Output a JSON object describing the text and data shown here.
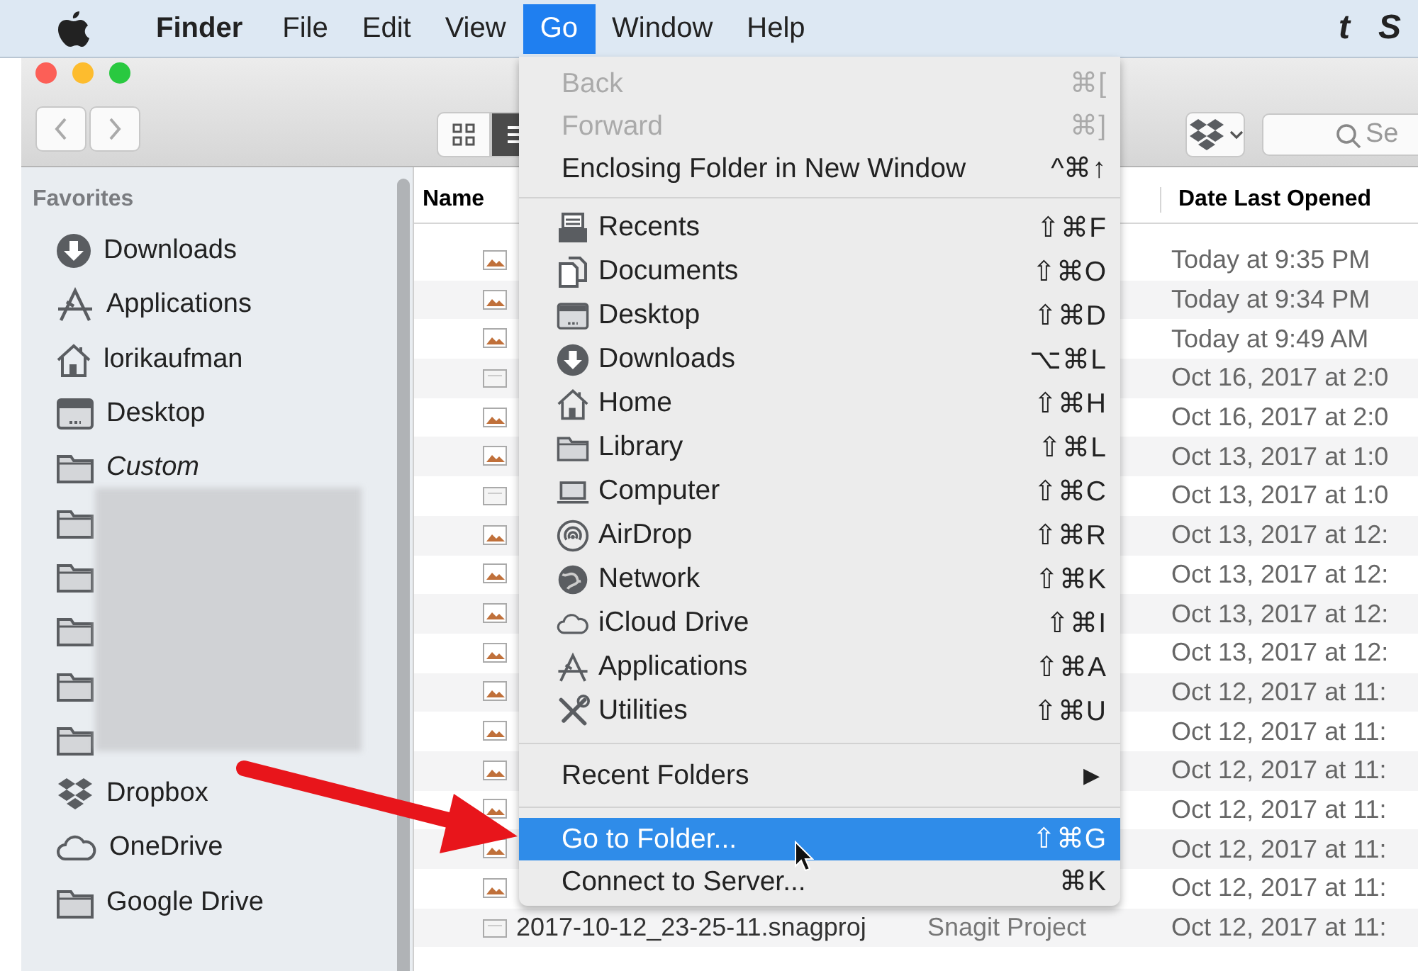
{
  "menu_bar": {
    "app_name": "Finder",
    "menus": [
      {
        "label": "File",
        "selected": false
      },
      {
        "label": "Edit",
        "selected": false
      },
      {
        "label": "View",
        "selected": false
      },
      {
        "label": "Go",
        "selected": true
      },
      {
        "label": "Window",
        "selected": false
      },
      {
        "label": "Help",
        "selected": false
      }
    ],
    "status_items": [
      "t",
      "S"
    ]
  },
  "toolbar": {
    "search": {
      "placeholder": "Se"
    },
    "view_buttons": [
      {
        "kind": "icons",
        "selected": false
      },
      {
        "kind": "list",
        "selected": true
      }
    ]
  },
  "sidebar": {
    "heading": "Favorites",
    "items": [
      {
        "kind": "downloads",
        "label": "Downloads"
      },
      {
        "kind": "applications",
        "label": "Applications"
      },
      {
        "kind": "home",
        "label": "lorikaufman"
      },
      {
        "kind": "desktop",
        "label": "Desktop"
      },
      {
        "kind": "folder",
        "label": "Custom",
        "italic": true
      },
      {
        "kind": "folder"
      },
      {
        "kind": "folder"
      },
      {
        "kind": "folder"
      },
      {
        "kind": "folder"
      },
      {
        "kind": "folder"
      },
      {
        "kind": "dropbox",
        "label": "Dropbox"
      },
      {
        "kind": "cloud",
        "label": "OneDrive"
      },
      {
        "kind": "folder",
        "label": "Google Drive"
      }
    ]
  },
  "file_list": {
    "columns": {
      "name": "Name",
      "date": "Date Last Opened"
    },
    "rows": [
      {
        "kind": "image",
        "date": "Today at 9:35 PM"
      },
      {
        "kind": "image",
        "date": "Today at 9:34 PM"
      },
      {
        "kind": "image",
        "date": "Today at 9:49 AM"
      },
      {
        "kind": "document",
        "date": "Oct 16, 2017 at 2:0"
      },
      {
        "kind": "image",
        "date": "Oct 16, 2017 at 2:0"
      },
      {
        "kind": "image",
        "date": "Oct 13, 2017 at 1:0"
      },
      {
        "kind": "document",
        "date": "Oct 13, 2017 at 1:0"
      },
      {
        "kind": "image",
        "date": "Oct 13, 2017 at 12:"
      },
      {
        "kind": "image",
        "date": "Oct 13, 2017 at 12:"
      },
      {
        "kind": "image",
        "date": "Oct 13, 2017 at 12:"
      },
      {
        "kind": "image",
        "date": "Oct 13, 2017 at 12:"
      },
      {
        "kind": "image",
        "date": "Oct 12, 2017 at 11:"
      },
      {
        "kind": "image",
        "date": "Oct 12, 2017 at 11:"
      },
      {
        "kind": "image",
        "date": "Oct 12, 2017 at 11:"
      },
      {
        "kind": "image",
        "date": "Oct 12, 2017 at 11:"
      },
      {
        "kind": "image",
        "date": "Oct 12, 2017 at 11:"
      },
      {
        "kind": "image",
        "date": "Oct 12, 2017 at 11:"
      },
      {
        "kind": "document",
        "name": "2017-10-12_23-25-11.snagproj",
        "type": "Snagit Project",
        "date": "Oct 12, 2017 at 11:"
      }
    ]
  },
  "go_menu": {
    "sections": [
      [
        {
          "label": "Back",
          "shortcut": "⌘[",
          "disabled": true
        },
        {
          "label": "Forward",
          "shortcut": "⌘]",
          "disabled": true
        },
        {
          "label": "Enclosing Folder in New Window",
          "shortcut": "^⌘↑",
          "disabled": false
        }
      ],
      [
        {
          "kind": "recents",
          "label": "Recents",
          "shortcut": "⇧⌘F",
          "disabled": false
        },
        {
          "kind": "documents",
          "label": "Documents",
          "shortcut": "⇧⌘O",
          "disabled": false
        },
        {
          "kind": "desktop",
          "label": "Desktop",
          "shortcut": "⇧⌘D",
          "disabled": false
        },
        {
          "kind": "downloads",
          "label": "Downloads",
          "shortcut": "⌥⌘L",
          "disabled": false
        },
        {
          "kind": "home",
          "label": "Home",
          "shortcut": "⇧⌘H",
          "disabled": false
        },
        {
          "kind": "folder",
          "label": "Library",
          "shortcut": "⇧⌘L",
          "disabled": false
        },
        {
          "kind": "computer",
          "label": "Computer",
          "shortcut": "⇧⌘C",
          "disabled": false
        },
        {
          "kind": "airdrop",
          "label": "AirDrop",
          "shortcut": "⇧⌘R",
          "disabled": false
        },
        {
          "kind": "network",
          "label": "Network",
          "shortcut": "⇧⌘K",
          "disabled": false
        },
        {
          "kind": "cloud",
          "label": "iCloud Drive",
          "shortcut": "⇧⌘I",
          "disabled": false
        },
        {
          "kind": "applications",
          "label": "Applications",
          "shortcut": "⇧⌘A",
          "disabled": false
        },
        {
          "kind": "utilities",
          "label": "Utilities",
          "shortcut": "⇧⌘U",
          "disabled": false
        }
      ],
      [
        {
          "label": "Recent Folders",
          "submenu": "▶",
          "disabled": false
        }
      ],
      [
        {
          "label": "Go to Folder...",
          "shortcut": "⇧⌘G",
          "selected": true,
          "disabled": false
        },
        {
          "label": "Connect to Server...",
          "shortcut": "⌘K",
          "selected": false,
          "disabled": false
        }
      ]
    ]
  }
}
